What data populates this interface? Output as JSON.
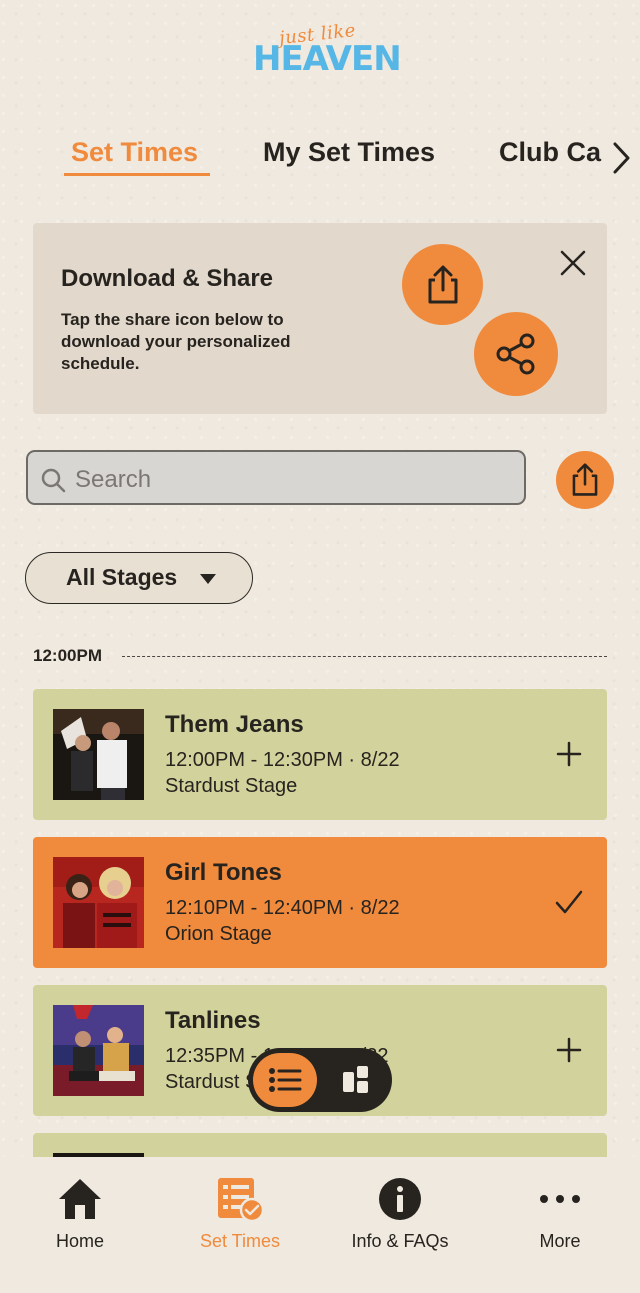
{
  "logo": {
    "script": "just like",
    "main": "HEAVEN"
  },
  "tabs": [
    {
      "label": "Set Times",
      "active": true
    },
    {
      "label": "My Set Times",
      "active": false
    },
    {
      "label": "Club Ca",
      "active": false
    }
  ],
  "share_card": {
    "title": "Download & Share",
    "description": "Tap the share icon below to download your personalized schedule."
  },
  "search": {
    "placeholder": "Search"
  },
  "filter": {
    "label": "All Stages"
  },
  "time_group": {
    "label": "12:00PM"
  },
  "sets": [
    {
      "name": "Them Jeans",
      "time": "12:00PM - 12:30PM · 8/22",
      "stage": "Stardust Stage",
      "selected": false,
      "action_icon": "plus-icon"
    },
    {
      "name": "Girl Tones",
      "time": "12:10PM - 12:40PM · 8/22",
      "stage": "Orion Stage",
      "selected": true,
      "action_icon": "check-icon"
    },
    {
      "name": "Tanlines",
      "time": "12:35PM - 1:05PM · 8/22",
      "stage": "Stardust Stage",
      "selected": false,
      "action_icon": "plus-icon"
    }
  ],
  "view_toggle": {
    "list_icon": "list-icon",
    "grid_icon": "grid-icon"
  },
  "bottom_nav": [
    {
      "label": "Home",
      "icon": "home-icon",
      "active": false
    },
    {
      "label": "Set Times",
      "icon": "schedule-icon",
      "active": true
    },
    {
      "label": "Info & FAQs",
      "icon": "info-icon",
      "active": false
    },
    {
      "label": "More",
      "icon": "more-icon",
      "active": false
    }
  ],
  "colors": {
    "accent": "#f08a3c",
    "card_green": "#d2d39c",
    "background": "#efe9df",
    "logo_blue": "#56b7e6",
    "text_dark": "#27231f"
  }
}
